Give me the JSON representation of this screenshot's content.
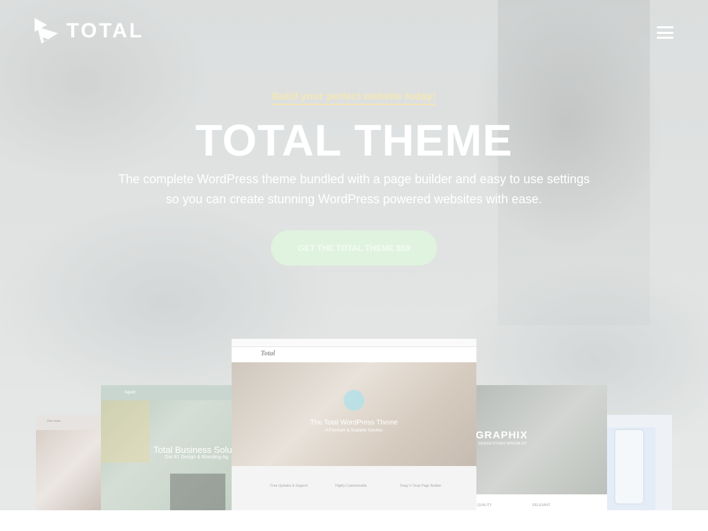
{
  "header": {
    "logo_text": "TOTAL",
    "logo_icon": "total-logo-icon",
    "menu_icon": "hamburger-menu-icon"
  },
  "hero": {
    "tagline": "Build your perfect website today!",
    "title": "TOTAL THEME",
    "subtitle": "The complete WordPress theme bundled with a page builder and easy to use settings so you can create stunning WordPress powered websites with ease.",
    "cta_label": "GET THE TOTAL THEME $59"
  },
  "showcase": {
    "left_outer_label": "Filter Index",
    "left_inner": {
      "logo": "Agent",
      "title": "Total Business Solu",
      "subtitle": "Our #1 Design & Branding Ag"
    },
    "center": {
      "logo": "Total",
      "title": "The Total WordPress Theme",
      "subtitle": "A Premium & Scalable Solution",
      "features": [
        "Free Updates & Support",
        "Highly Customizable",
        "Drag 'n' Drop Page Builder"
      ]
    },
    "right_inner": {
      "title": "GRAPHIX",
      "subtitle": "DESIGN STUDIO SPECIALIST",
      "footer_items": [
        "QUALITY",
        "RELEVANT"
      ]
    }
  },
  "colors": {
    "tagline": "#f3e7b4",
    "cta_bg": "#dff3de",
    "text": "#ffffff"
  }
}
